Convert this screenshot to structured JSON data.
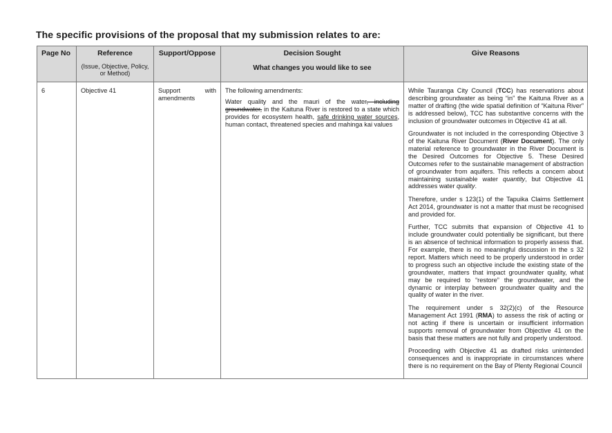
{
  "heading": "The specific provisions of the proposal that my submission relates to are:",
  "table": {
    "headers": {
      "page_no": "Page No",
      "reference": "Reference",
      "reference_sub": "(Issue, Objective, Policy, or Method)",
      "support": "Support/Oppose",
      "decision": "Decision Sought",
      "decision_sub": "What changes you would like to see",
      "reasons": "Give Reasons"
    },
    "row": {
      "page_no": "6",
      "reference": "Objective 41",
      "support_word1": "Support",
      "support_word2": "with",
      "support_word3": "amendments",
      "decision_intro": "The following amendments:",
      "decision_part1": "Water quality and the mauri of the water",
      "decision_struck": ", including groundwater,",
      "decision_part2": " in the Kaituna River is restored to a state which provides for ecosystem health, ",
      "decision_underlined": "safe drinking water sources",
      "decision_part3": ", human contact, threatened species and mahinga kai values",
      "reasons": {
        "p1_a": "While Tauranga City Council (",
        "p1_tcc": "TCC",
        "p1_b": ") has reservations about describing groundwater as being “in” the Kaituna River as a matter of drafting (the wide spatial definition of “Kaituna River” is addressed below), TCC has substantive concerns with the inclusion of groundwater outcomes in Objective 41 at all.",
        "p2_a": "Groundwater is not included in the corresponding Objective 3 of the Kaituna River Document (",
        "p2_rd": "River Document",
        "p2_b": ").  The only material reference to groundwater in the River Document is the Desired Outcomes for Objective 5.  These Desired Outcomes refer to the sustainable management of abstraction of groundwater from aquifers.  This reflects a concern about maintaining sustainable water ",
        "p2_quantity": "quantity",
        "p2_c": ", but Objective 41 addresses water ",
        "p2_quality": "quality",
        "p2_d": ".",
        "p3": "Therefore, under s 123(1) of the Tapuika Claims Settlement Act 2014, groundwater is not a matter that must be recognised and provided for.",
        "p4": "Further, TCC submits that expansion of Objective 41 to include groundwater could potentially be significant, but there is an absence of technical information to properly assess that.  For example, there is no meaningful discussion in the s 32 report.  Matters which need to be properly understood in order to progress such an objective include the existing state of the groundwater, matters that impact groundwater quality, what may be required to “restore” the groundwater, and the dynamic or interplay between groundwater quality and the quality of water in the river.",
        "p5_a": "The requirement under s 32(2)(c) of the Resource Management Act 1991 (",
        "p5_rma": "RMA",
        "p5_b": ") to assess the risk of acting or not acting if there is uncertain or insufficient information supports removal of groundwater from Objective 41 on the basis that these matters are not fully and properly understood.",
        "p6": "Proceeding with Objective 41 as drafted risks unintended consequences and is inappropriate in circumstances where there is no requirement on the Bay of Plenty Regional Council"
      }
    }
  }
}
